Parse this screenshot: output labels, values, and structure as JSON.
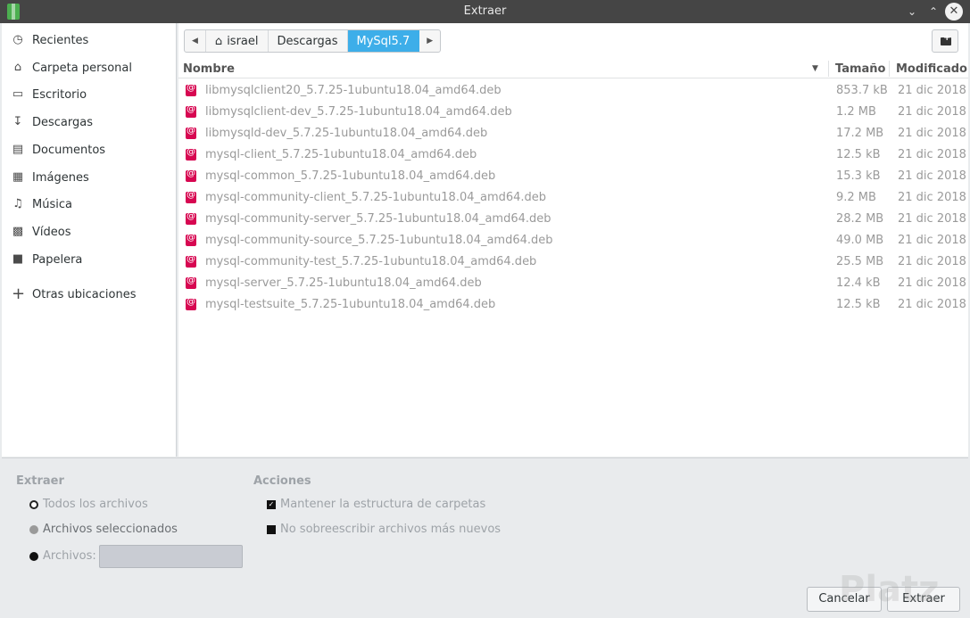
{
  "window": {
    "title": "Extraer"
  },
  "sidebar": {
    "items": [
      {
        "label": "Recientes",
        "icon": "clock-icon"
      },
      {
        "label": "Carpeta personal",
        "icon": "home-icon"
      },
      {
        "label": "Escritorio",
        "icon": "desktop-icon"
      },
      {
        "label": "Descargas",
        "icon": "download-icon"
      },
      {
        "label": "Documentos",
        "icon": "document-icon"
      },
      {
        "label": "Imágenes",
        "icon": "image-icon"
      },
      {
        "label": "Música",
        "icon": "music-icon"
      },
      {
        "label": "Vídeos",
        "icon": "video-icon"
      },
      {
        "label": "Papelera",
        "icon": "trash-icon"
      },
      {
        "label": "Otras ubicaciones",
        "icon": "plus-icon"
      }
    ]
  },
  "pathbar": {
    "segments": [
      "israel",
      "Descargas",
      "MySql5.7"
    ],
    "active": "MySql5.7"
  },
  "columns": {
    "name": "Nombre",
    "size": "Tamaño",
    "modified": "Modificado"
  },
  "files": [
    {
      "name": "libmysqlclient20_5.7.25-1ubuntu18.04_amd64.deb",
      "size": "853.7 kB",
      "modified": "21 dic 2018"
    },
    {
      "name": "libmysqlclient-dev_5.7.25-1ubuntu18.04_amd64.deb",
      "size": "1.2 MB",
      "modified": "21 dic 2018"
    },
    {
      "name": "libmysqld-dev_5.7.25-1ubuntu18.04_amd64.deb",
      "size": "17.2 MB",
      "modified": "21 dic 2018"
    },
    {
      "name": "mysql-client_5.7.25-1ubuntu18.04_amd64.deb",
      "size": "12.5 kB",
      "modified": "21 dic 2018"
    },
    {
      "name": "mysql-common_5.7.25-1ubuntu18.04_amd64.deb",
      "size": "15.3 kB",
      "modified": "21 dic 2018"
    },
    {
      "name": "mysql-community-client_5.7.25-1ubuntu18.04_amd64.deb",
      "size": "9.2 MB",
      "modified": "21 dic 2018"
    },
    {
      "name": "mysql-community-server_5.7.25-1ubuntu18.04_amd64.deb",
      "size": "28.2 MB",
      "modified": "21 dic 2018"
    },
    {
      "name": "mysql-community-source_5.7.25-1ubuntu18.04_amd64.deb",
      "size": "49.0 MB",
      "modified": "21 dic 2018"
    },
    {
      "name": "mysql-community-test_5.7.25-1ubuntu18.04_amd64.deb",
      "size": "25.5 MB",
      "modified": "21 dic 2018"
    },
    {
      "name": "mysql-server_5.7.25-1ubuntu18.04_amd64.deb",
      "size": "12.4 kB",
      "modified": "21 dic 2018"
    },
    {
      "name": "mysql-testsuite_5.7.25-1ubuntu18.04_amd64.deb",
      "size": "12.5 kB",
      "modified": "21 dic 2018"
    }
  ],
  "extract": {
    "title": "Extraer",
    "all_files": "Todos los archivos",
    "selected_files": "Archivos seleccionados",
    "files_label": "Archivos:",
    "files_value": "",
    "selected_option": "Todos los archivos"
  },
  "actions": {
    "title": "Acciones",
    "keep_structure": "Mantener la estructura de carpetas",
    "keep_structure_checked": true,
    "no_overwrite": "No sobreescribir archivos más nuevos",
    "no_overwrite_checked": false
  },
  "buttons": {
    "cancel": "Cancelar",
    "extract": "Extraer"
  },
  "watermark": "Platz"
}
